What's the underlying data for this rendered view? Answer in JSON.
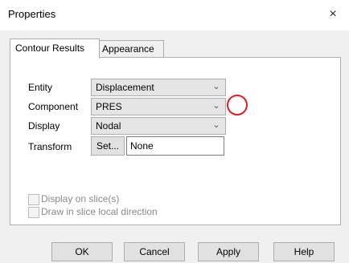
{
  "dialog": {
    "title": "Properties",
    "close_glyph": "×"
  },
  "tabs": [
    {
      "label": "Contour Results"
    },
    {
      "label": "Appearance"
    }
  ],
  "fields": {
    "entity": {
      "label": "Entity",
      "value": "Displacement"
    },
    "component": {
      "label": "Component",
      "value": "PRES"
    },
    "display": {
      "label": "Display",
      "value": "Nodal"
    },
    "transform": {
      "label": "Transform",
      "button": "Set...",
      "value": "None"
    }
  },
  "checkboxes": [
    {
      "label": "Display on slice(s)"
    },
    {
      "label": "Draw in slice local direction"
    }
  ],
  "buttons": {
    "ok": "OK",
    "cancel": "Cancel",
    "apply": "Apply",
    "help": "Help"
  },
  "icons": {
    "dropdown": "chevron-down-icon",
    "close": "close-icon"
  },
  "colors": {
    "highlight": "#e01b24"
  }
}
